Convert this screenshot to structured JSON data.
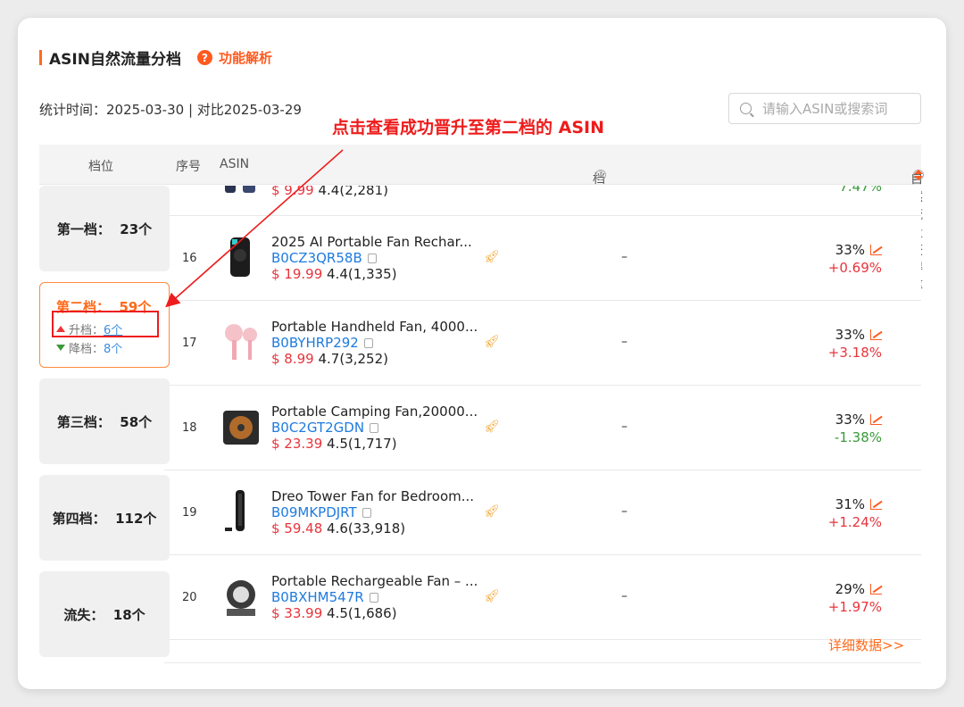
{
  "section": {
    "title": "ASIN自然流量分档",
    "help_label": "功能解析",
    "stat_time": "统计时间：2025-03-30 | 对比2025-03-29"
  },
  "search": {
    "placeholder": "请输入ASIN或搜索词"
  },
  "annotation": "点击查看成功晋升至第二档的 ASIN",
  "columns": {
    "tier": "档位",
    "seq": "序号",
    "asin": "ASIN",
    "change": "档位变化",
    "rate": "自然流量获得率"
  },
  "tiers": [
    {
      "label": "第一档：",
      "count": "23个"
    },
    {
      "label": "第二档：",
      "count": "59个",
      "up_label": "升档：",
      "up_count": "6个",
      "down_label": "降档：",
      "down_count": "8个"
    },
    {
      "label": "第三档：",
      "count": "58个"
    },
    {
      "label": "第四档：",
      "count": "112个"
    },
    {
      "label": "流失：",
      "count": "18个"
    }
  ],
  "partial_row": {
    "price": "$ 9.99",
    "rating": "4.4(2,281)",
    "delta": "7.47%"
  },
  "rows": [
    {
      "seq": "16",
      "name": "2025 AI Portable Fan Rechar...",
      "asin": "B0CZ3QR58B",
      "price": "$ 19.99",
      "rating": "4.4(1,335)",
      "change": "–",
      "rate": "33%",
      "delta": "+0.69%",
      "delta_dir": "up"
    },
    {
      "seq": "17",
      "name": "Portable Handheld Fan, 4000...",
      "asin": "B0BYHRP292",
      "price": "$ 8.99",
      "rating": "4.7(3,252)",
      "change": "–",
      "rate": "33%",
      "delta": "+3.18%",
      "delta_dir": "up"
    },
    {
      "seq": "18",
      "name": "Portable Camping Fan,20000...",
      "asin": "B0C2GT2GDN",
      "price": "$ 23.39",
      "rating": "4.5(1,717)",
      "change": "–",
      "rate": "33%",
      "delta": "-1.38%",
      "delta_dir": "down"
    },
    {
      "seq": "19",
      "name": "Dreo Tower Fan for Bedroom...",
      "asin": "B09MKPDJRT",
      "price": "$ 59.48",
      "rating": "4.6(33,918)",
      "change": "–",
      "rate": "31%",
      "delta": "+1.24%",
      "delta_dir": "up"
    },
    {
      "seq": "20",
      "name": "Portable Rechargeable Fan – ...",
      "asin": "B0BXHM547R",
      "price": "$ 33.99",
      "rating": "4.5(1,686)",
      "change": "–",
      "rate": "29%",
      "delta": "+1.97%",
      "delta_dir": "up"
    }
  ],
  "detail_link": "详细数据>>",
  "colors": {
    "accent": "#ff6a1a",
    "link": "#1e7be0",
    "price": "#e8343c",
    "annotation": "#ee1c1c"
  }
}
